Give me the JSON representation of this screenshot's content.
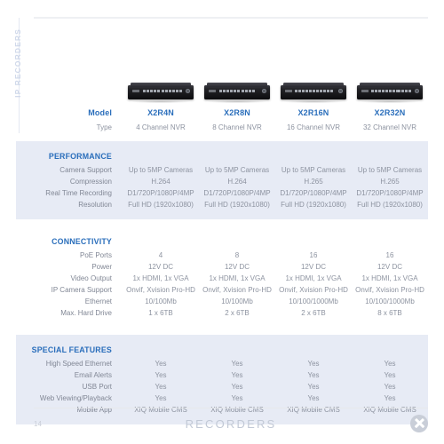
{
  "side_tab": {
    "label": "IP RECORDERS"
  },
  "header": {
    "model_label": "Model",
    "type_label": "Type"
  },
  "products": [
    {
      "model": "X2R4N",
      "type": "4 Channel NVR",
      "device": "nvr-4ch"
    },
    {
      "model": "X2R8N",
      "type": "8 Channel NVR",
      "device": "nvr-8ch"
    },
    {
      "model": "X2R16N",
      "type": "16 Channel NVR",
      "device": "nvr-16ch"
    },
    {
      "model": "X2R32N",
      "type": "32 Channel NVR",
      "device": "nvr-32ch"
    }
  ],
  "sections": [
    {
      "title": "PERFORMANCE",
      "shaded": true,
      "rows": [
        {
          "label": "Camera Support",
          "values": [
            "Up to 5MP Cameras",
            "Up to 5MP Cameras",
            "Up to 5MP Cameras",
            "Up to 5MP Cameras"
          ]
        },
        {
          "label": "Compression",
          "values": [
            "H.264",
            "H.264",
            "H.265",
            "H.265"
          ]
        },
        {
          "label": "Real Time Recording",
          "values": [
            "D1/720P/1080P/4MP",
            "D1/720P/1080P/4MP",
            "D1/720P/1080P/4MP",
            "D1/720P/1080P/4MP"
          ]
        },
        {
          "label": "Resolution",
          "values": [
            "Full HD (1920x1080)",
            "Full HD (1920x1080)",
            "Full HD (1920x1080)",
            "Full HD (1920x1080)"
          ]
        }
      ]
    },
    {
      "title": "CONNECTIVITY",
      "shaded": false,
      "rows": [
        {
          "label": "PoE Ports",
          "values": [
            "4",
            "8",
            "16",
            "16"
          ]
        },
        {
          "label": "Power",
          "values": [
            "12V DC",
            "12V DC",
            "12V DC",
            "12V DC"
          ]
        },
        {
          "label": "Video Output",
          "values": [
            "1x HDMI, 1x VGA",
            "1x HDMI, 1x VGA",
            "1x HDMI, 1x VGA",
            "1x HDMI, 1x VGA"
          ]
        },
        {
          "label": "IP Camera Support",
          "values": [
            "Onvif, Xvision Pro-HD",
            "Onvif, Xvision Pro-HD",
            "Onvif, Xvision Pro-HD",
            "Onvif, Xvision Pro-HD"
          ]
        },
        {
          "label": "Ethernet",
          "values": [
            "10/100Mb",
            "10/100Mb",
            "10/100/1000Mb",
            "10/100/1000Mb"
          ]
        },
        {
          "label": "Max. Hard Drive",
          "values": [
            "1 x 6TB",
            "2 x 6TB",
            "2 x 6TB",
            "8 x 6TB"
          ]
        }
      ]
    },
    {
      "title": "SPECIAL FEATURES",
      "shaded": true,
      "rows": [
        {
          "label": "High Speed Ethernet",
          "values": [
            "Yes",
            "Yes",
            "Yes",
            "Yes"
          ]
        },
        {
          "label": "Email Alerts",
          "values": [
            "Yes",
            "Yes",
            "Yes",
            "Yes"
          ]
        },
        {
          "label": "USB Port",
          "values": [
            "Yes",
            "Yes",
            "Yes",
            "Yes"
          ]
        },
        {
          "label": "Web Viewing/Playback",
          "values": [
            "Yes",
            "Yes",
            "Yes",
            "Yes"
          ]
        },
        {
          "label": "Mobile App",
          "values": [
            "XIQ Mobile CMS",
            "XIQ Mobile CMS",
            "XIQ Mobile CMS",
            "XIQ Mobile CMS"
          ]
        }
      ]
    }
  ],
  "footer": {
    "page_number": "14",
    "title": "RECORDERS",
    "logo": "x-circle-logo"
  },
  "colors": {
    "accent_blue": "#2a6ebb",
    "band_shaded": "#e7ebf5",
    "label_grey": "#818795",
    "value_grey": "#8d93a0",
    "footer_grey": "#c2c9d6"
  }
}
